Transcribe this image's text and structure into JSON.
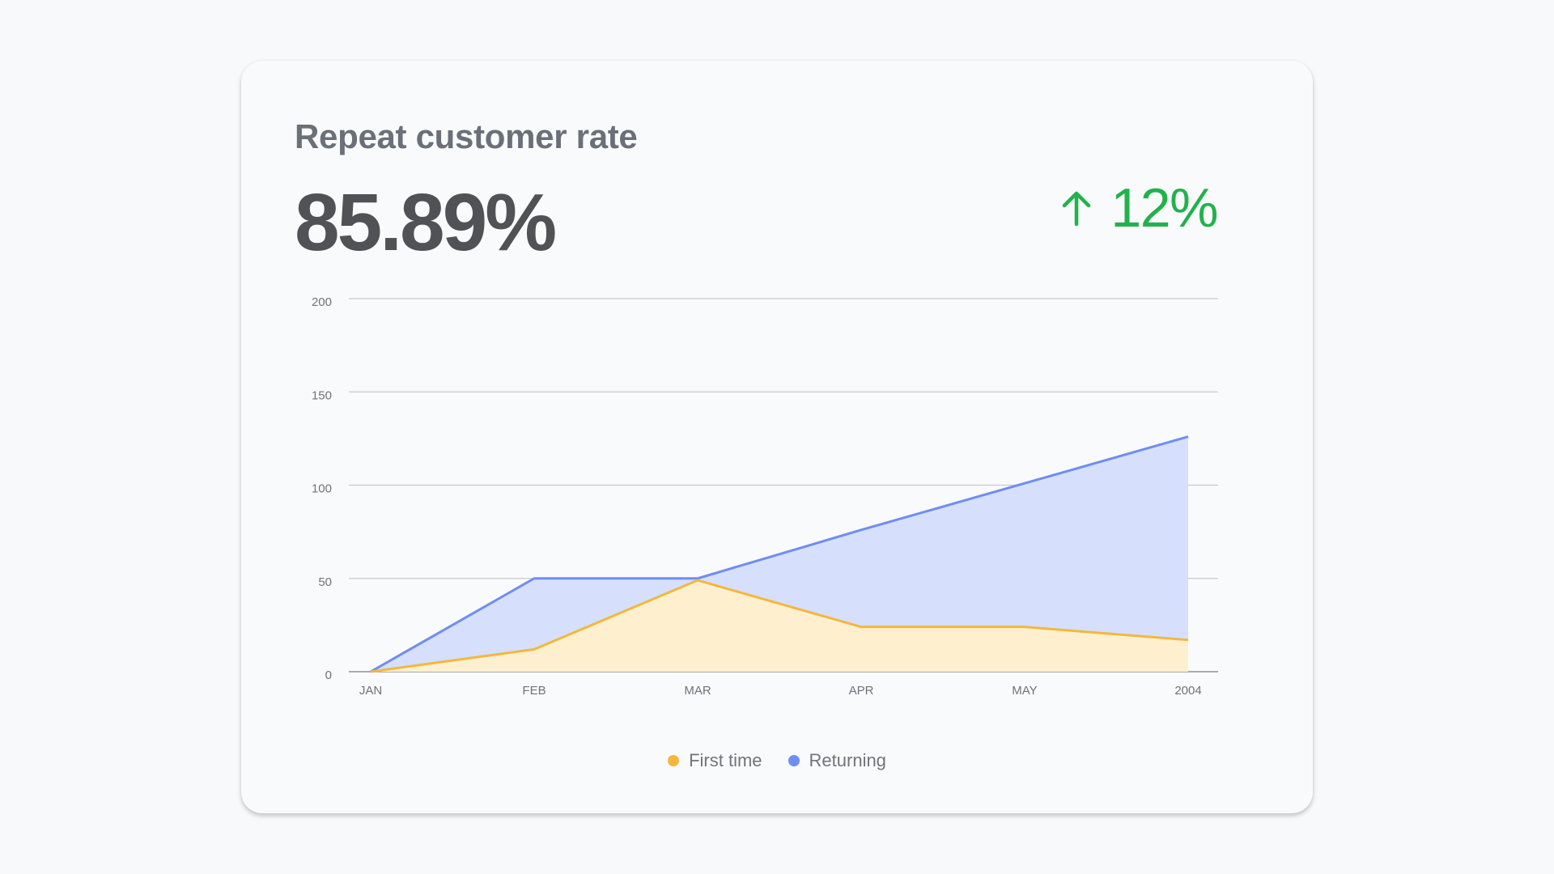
{
  "card": {
    "title": "Repeat customer rate",
    "value": "85.89%",
    "delta": {
      "direction": "up",
      "value": "12%",
      "icon": "arrow-up-icon",
      "color": "#22b24c"
    }
  },
  "chart_data": {
    "type": "area",
    "categories": [
      "JAN",
      "FEB",
      "MAR",
      "APR",
      "MAY",
      "2004"
    ],
    "ylim": [
      0,
      200
    ],
    "yticks": [
      0,
      50,
      100,
      150,
      200
    ],
    "grid": true,
    "legend_position": "bottom-center",
    "series": [
      {
        "name": "First time",
        "values": [
          0,
          12,
          49,
          24,
          24,
          17
        ],
        "color": "#f4b73e",
        "fill": "#fef0cf"
      },
      {
        "name": "Returning",
        "values": [
          0,
          50,
          50,
          76,
          101,
          126
        ],
        "color": "#6f8df2",
        "fill": "#d6e0fd"
      }
    ]
  }
}
